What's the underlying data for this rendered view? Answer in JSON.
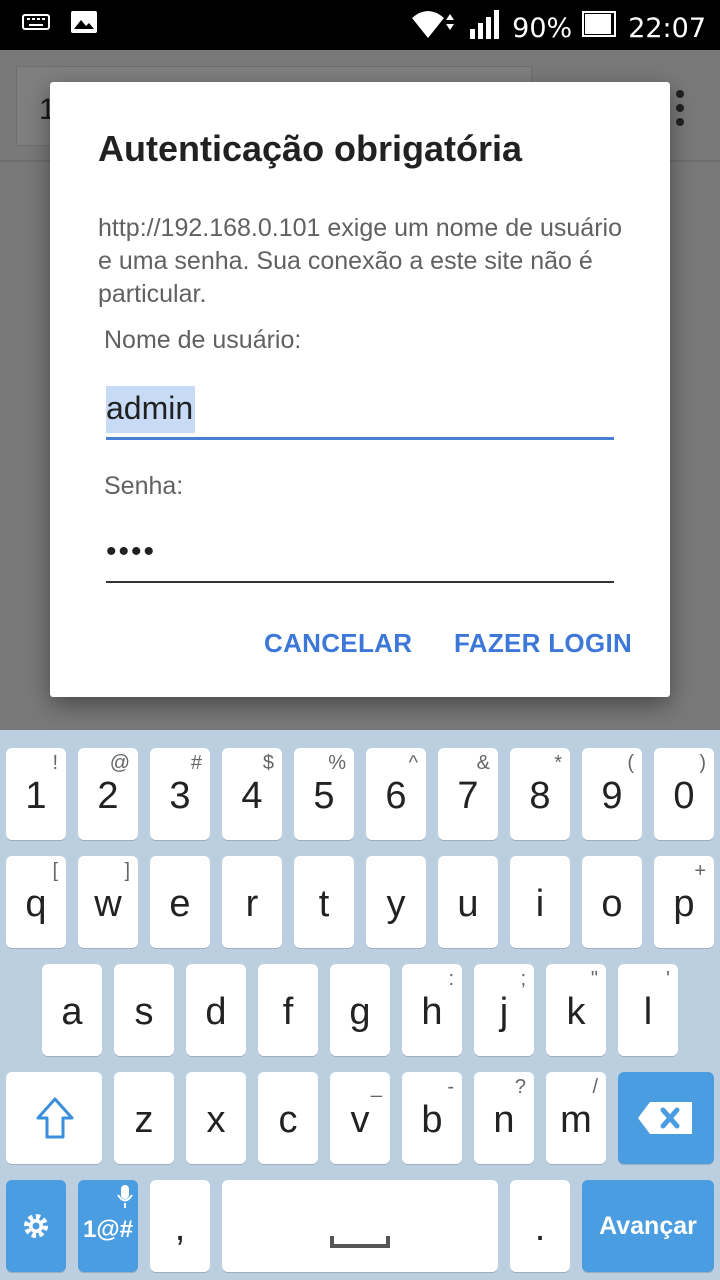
{
  "status_bar": {
    "battery": "90%",
    "time": "22:07"
  },
  "browser": {
    "url_partial": "1"
  },
  "dialog": {
    "title": "Autenticação obrigatória",
    "message": "http://192.168.0.101 exige um nome de usuário e uma senha. Sua conexão a este site não é particular.",
    "username_label": "Nome de usuário:",
    "username_value": "admin",
    "password_label": "Senha:",
    "password_value": "••••",
    "cancel_label": "CANCELAR",
    "login_label": "FAZER LOGIN"
  },
  "keyboard": {
    "row_numbers": [
      {
        "main": "1",
        "hint": "!"
      },
      {
        "main": "2",
        "hint": "@"
      },
      {
        "main": "3",
        "hint": "#"
      },
      {
        "main": "4",
        "hint": "$"
      },
      {
        "main": "5",
        "hint": "%"
      },
      {
        "main": "6",
        "hint": "^"
      },
      {
        "main": "7",
        "hint": "&"
      },
      {
        "main": "8",
        "hint": "*"
      },
      {
        "main": "9",
        "hint": "("
      },
      {
        "main": "0",
        "hint": ")"
      }
    ],
    "row_q": [
      {
        "main": "q",
        "hint": "["
      },
      {
        "main": "w",
        "hint": "]"
      },
      {
        "main": "e",
        "hint": ""
      },
      {
        "main": "r",
        "hint": ""
      },
      {
        "main": "t",
        "hint": ""
      },
      {
        "main": "y",
        "hint": ""
      },
      {
        "main": "u",
        "hint": ""
      },
      {
        "main": "i",
        "hint": ""
      },
      {
        "main": "o",
        "hint": ""
      },
      {
        "main": "p",
        "hint": "+"
      }
    ],
    "row_a": [
      {
        "main": "a",
        "hint": ""
      },
      {
        "main": "s",
        "hint": ""
      },
      {
        "main": "d",
        "hint": ""
      },
      {
        "main": "f",
        "hint": ""
      },
      {
        "main": "g",
        "hint": ""
      },
      {
        "main": "h",
        "hint": ":"
      },
      {
        "main": "j",
        "hint": ";"
      },
      {
        "main": "k",
        "hint": "\""
      },
      {
        "main": "l",
        "hint": "'"
      }
    ],
    "row_z": [
      {
        "main": "z",
        "hint": ""
      },
      {
        "main": "x",
        "hint": ""
      },
      {
        "main": "c",
        "hint": ""
      },
      {
        "main": "v",
        "hint": "_"
      },
      {
        "main": "b",
        "hint": "-"
      },
      {
        "main": "n",
        "hint": "?"
      },
      {
        "main": "m",
        "hint": "/"
      }
    ],
    "symbols_label": "1@#",
    "comma": ",",
    "period": ".",
    "action_label": "Avançar"
  },
  "colors": {
    "accent": "#3d78d8",
    "keyboard_bg": "#bccfe0",
    "action_key": "#4a9de0"
  }
}
